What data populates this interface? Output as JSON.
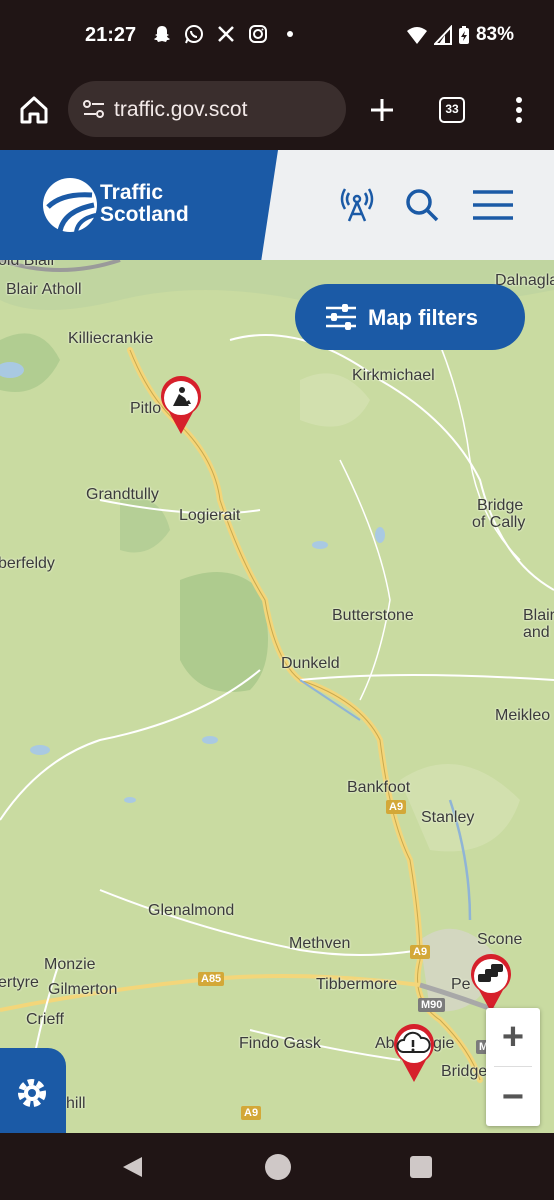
{
  "status_bar": {
    "time": "21:27",
    "battery": "83%",
    "notification_icons": [
      "snapchat-icon",
      "whatsapp-icon",
      "x-icon",
      "instagram-icon",
      "dot-icon"
    ]
  },
  "browser": {
    "url": "traffic.gov.scot",
    "tab_count": "33"
  },
  "site": {
    "logo_line1": "Traffic",
    "logo_line2": "Scotland"
  },
  "map": {
    "filters_label": "Map filters",
    "zoom_in": "+",
    "zoom_out": "−",
    "places": {
      "blair_atholl": "Blair Atholl",
      "killiecrankie": "Killiecrankie",
      "pitlochry": "Pitlo",
      "kirkmichael": "Kirkmichael",
      "grandtully": "Grandtully",
      "logierait": "Logierait",
      "bridge_of_cally_1": "Bridge",
      "bridge_of_cally_2": "of Cally",
      "aberfeldy": "berfeldy",
      "butterstone": "Butterstone",
      "blair_1": "Blair",
      "blair_2": "and",
      "dunkeld": "Dunkeld",
      "meikleour": "Meikleo",
      "bankfoot": "Bankfoot",
      "stanley": "Stanley",
      "glenalmond": "Glenalmond",
      "scone": "Scone",
      "methven": "Methven",
      "monzie": "Monzie",
      "tibbermore": "Tibbermore",
      "perth": "Pe",
      "crieff_ertyre": "ertyre",
      "gilmerton": "Gilmerton",
      "crieff": "Crieff",
      "findo_gask": "Findo Gask",
      "aberdalgie": "Ab",
      "aberdalgie2": "gie",
      "bridge_of_earn": "Bridge",
      "bridge_of_earn2": "n",
      "dalnaglar": "Dalnaglar",
      "old_blair": "old Blair",
      "hill": "hill"
    },
    "roads": {
      "a9_1": "A9",
      "a9_2": "A9",
      "a9_3": "A9",
      "a85": "A85",
      "m90": "M90",
      "m9": "M"
    },
    "markers": [
      "roadworks-marker",
      "queue-marker",
      "weather-warning-marker"
    ]
  },
  "colors": {
    "brand_blue": "#1b5aa6",
    "marker_red": "#d6202b",
    "map_green": "#c9dba1",
    "road_yellow": "#f3d67a"
  }
}
